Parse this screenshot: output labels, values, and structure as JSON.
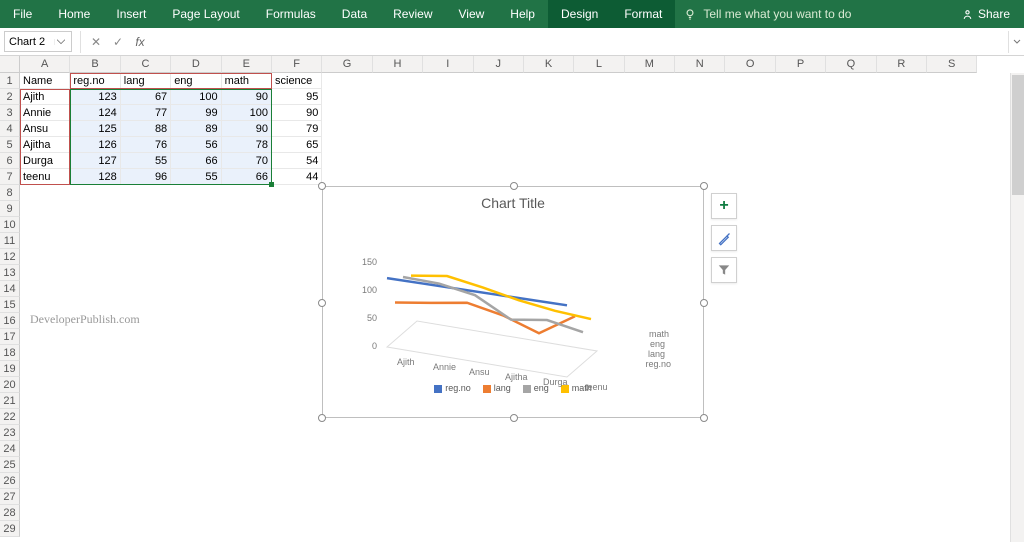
{
  "ribbon": {
    "tabs": [
      "File",
      "Home",
      "Insert",
      "Page Layout",
      "Formulas",
      "Data",
      "Review",
      "View",
      "Help",
      "Design",
      "Format"
    ],
    "tell_me": "Tell me what you want to do",
    "share": "Share"
  },
  "namebox": {
    "value": "Chart 2"
  },
  "columns": [
    "A",
    "B",
    "C",
    "D",
    "E",
    "F",
    "G",
    "H",
    "I",
    "J",
    "K",
    "L",
    "M",
    "N",
    "O",
    "P",
    "Q",
    "R",
    "S"
  ],
  "rowCount": 29,
  "data": {
    "headers": [
      "Name",
      "reg.no",
      "lang",
      "eng",
      "math",
      "science"
    ],
    "rows": [
      {
        "name": "Ajith",
        "reg": 123,
        "lang": 67,
        "eng": 100,
        "math": 90,
        "science": 95
      },
      {
        "name": "Annie",
        "reg": 124,
        "lang": 77,
        "eng": 99,
        "math": 100,
        "science": 90
      },
      {
        "name": "Ansu",
        "reg": 125,
        "lang": 88,
        "eng": 89,
        "math": 90,
        "science": 79
      },
      {
        "name": "Ajitha",
        "reg": 126,
        "lang": 76,
        "eng": 56,
        "math": 78,
        "science": 65
      },
      {
        "name": "Durga",
        "reg": 127,
        "lang": 55,
        "eng": 66,
        "math": 70,
        "science": 54
      },
      {
        "name": "teenu",
        "reg": 128,
        "lang": 96,
        "eng": 55,
        "math": 66,
        "science": 44
      }
    ]
  },
  "watermark": "DeveloperPublish.com",
  "chart_data": {
    "type": "line",
    "title": "Chart Title",
    "categories": [
      "Ajith",
      "Annie",
      "Ansu",
      "Ajitha",
      "Durga",
      "teenu"
    ],
    "depth_labels": [
      "reg.no",
      "lang",
      "eng",
      "math"
    ],
    "series": [
      {
        "name": "reg.no",
        "color": "#4472C4",
        "values": [
          123,
          124,
          125,
          126,
          127,
          128
        ]
      },
      {
        "name": "lang",
        "color": "#ED7D31",
        "values": [
          67,
          77,
          88,
          76,
          55,
          96
        ]
      },
      {
        "name": "eng",
        "color": "#A5A5A5",
        "values": [
          100,
          99,
          89,
          56,
          66,
          55
        ]
      },
      {
        "name": "math",
        "color": "#FFC000",
        "values": [
          90,
          100,
          90,
          78,
          70,
          66
        ]
      }
    ],
    "ylim": [
      0,
      150
    ],
    "yticks": [
      0,
      50,
      100,
      150
    ]
  },
  "chart_side": {
    "add": "+",
    "brush": "brush-icon",
    "filter": "filter-icon"
  }
}
